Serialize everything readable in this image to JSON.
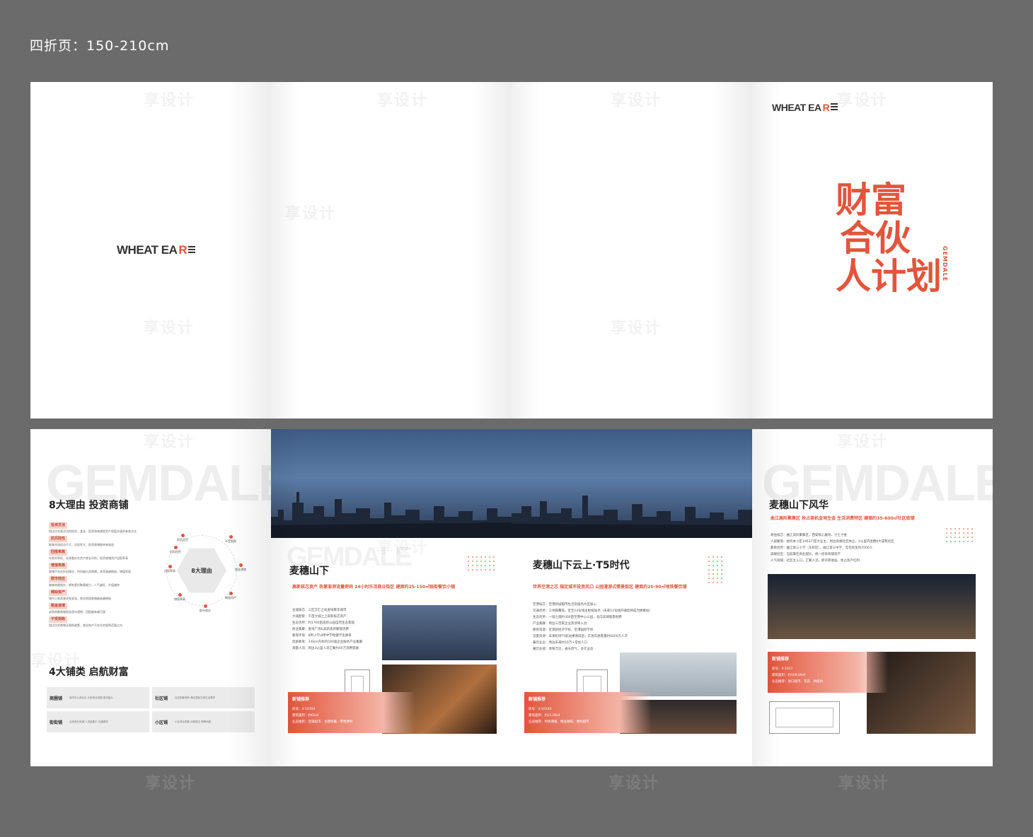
{
  "spec_label": "四折页：150-210cm",
  "brand": {
    "logo_main": "WHEAT EA",
    "logo_r": "R",
    "watermark": "享设计"
  },
  "cover": {
    "title_line1": "财富",
    "title_line2": "合伙",
    "title_line3": "人计划",
    "vertical_brand": "GEMDALE"
  },
  "panel5": {
    "bg_word": "GEMDALE",
    "title": "8大理由 投资商铺",
    "reasons": [
      {
        "t": "投资灵活",
        "d": "相比住宅更灵活的投资，类金、投资和商铺是资产保值升值的有效方式"
      },
      {
        "t": "抗风险性",
        "d": "能够市场扰动不大，风险性大，投资商铺能带来收益"
      },
      {
        "t": "回报率高",
        "d": "存款利率低，长线看存在资产增长风险，投资商铺资产回报率高"
      },
      {
        "t": "增值率高",
        "d": "商铺不存在折旧情况，时间越久的商铺，其资源越稀缺，增值率高"
      },
      {
        "t": "群市效应",
        "d": "聚集商圈效应，拥有更好聚客能力，人气越旺，升值越快"
      },
      {
        "t": "稀缺资产",
        "d": "城市土地资源逐渐紧张，商业地段商铺越来越稀缺"
      },
      {
        "t": "租金递增",
        "d": "成熟商圈商铺租金逐年递增，回报越来越可观"
      },
      {
        "t": "不受限购",
        "d": "相比住宅商铺无限购政策，商业地产不在住宅限购范围之内"
      }
    ],
    "hex_label": "8大理由",
    "nodes": [
      "投资灵活",
      "不受限购",
      "租金递增",
      "稀缺资产",
      "群市效应",
      "增值率高",
      "回报率高",
      "抗风险性"
    ],
    "shop_title": "4大铺类 启航财富",
    "shops": [
      {
        "name": "商圈铺",
        "desc": "城市中心商业区 大型综合商圈 客流量大"
      },
      {
        "name": "社区铺",
        "desc": "社区配套底商 满足居民日常生活需求"
      },
      {
        "name": "街街铺",
        "desc": "沿街商业街铺 人流量集中 交通便利"
      },
      {
        "name": "小区铺",
        "desc": "小区商业配套 消费稳定 刚需消费"
      }
    ]
  },
  "panel6": {
    "bg_word": "GEMDALE",
    "title": "麦穗山下",
    "subtitle": "高新核芯资产 热掌澎湃流量密码   24小时乐活商业街区   建面约25-150㎡临街餐饮小铺",
    "info": [
      "主城核芯：三区交汇之处金域黄华城市",
      "大城配套：千亩大城之上高新核芯资产",
      "生态优势：约1700亩高新公园自然生态景观",
      "商业集聚：金地广场&高新高新聚落消费",
      "教育环境：6所小学/4所中学稳健学生教育",
      "优质教育：3.6km内有约500强企业服务产业集聚",
      "海量人流：周边3公里人流汇聚约40万消费客群"
    ],
    "box_title": "新铺推荐",
    "box_lines": [
      "房号：4-10104",
      "建筑面积：约62㎡",
      "业态推荐：连锁超市、主题快餐、零售便利"
    ]
  },
  "panel7": {
    "title": "麦穗山下云上·T5时代",
    "subtitle": "世界空港之芯 锚定城市投资风口   公园漫游式情景街区 建面约20-90㎡地铁餐饮铺",
    "info": [
      "空港核芯：空港新城都市生活及服务片区核心",
      "交通优势：三地铁覆盖，近至14号线主枢纽站点（未来12号线开通后将成为换乘站）",
      "生态优势：一墙之隔约300亩空港中心公园，北向滨湖观景视野",
      "产业集群：周边三百家企业及项目入驻",
      "教育资源：近源新经济学校，空港国际学校",
      "流量资源：未来机场T5航站楼落成后，实现年旅客量约6000万人次",
      "餐饮业态：周边未来约10万+常住人口",
      "餐饮业绩：地铁万达，通天府气，多元业态"
    ],
    "box_title": "新铺推荐",
    "box_lines": [
      "房号：4-10144",
      "建筑面积：约21.08㎡",
      "业态推荐：时尚潮餐、精品咖啡、便利超市"
    ]
  },
  "panel8": {
    "bg_word": "GEMDALE",
    "title": "麦穗山下风华",
    "subtitle": "曲江高阶聚集区 抢占商机金地生金   生活消费特区 建面约35-600㎡社区底铺",
    "info": [
      "商住核芯：曲江高阶聚集区，西安核心腹地，寸土寸金",
      "人居聚落：依托本小区1963户庞大业主，周边高端社区林立，2公里内坐拥9大成熟社区",
      "教育优势：曲江第三小学（东校区），曲江第三中学，年在校生约2500人",
      "高端社区：当前最佳商业配比，统一招商商铺资产",
      "人气商铺：社区主入口，汇聚人流，即买即收益，抢占资产红利"
    ],
    "box_title": "新铺推荐",
    "box_lines": [
      "房号：4-1017",
      "建筑面积：约109.09㎡",
      "业态推荐：进口超市、花店、烘焙坊"
    ]
  }
}
